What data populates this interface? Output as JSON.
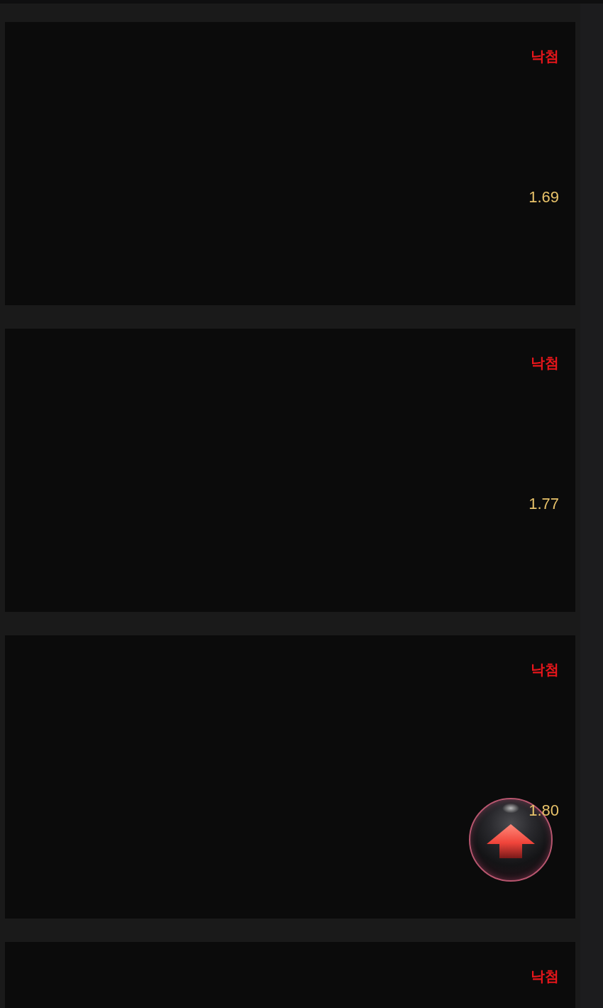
{
  "results": [
    {
      "status": "낙첨",
      "odds": "1.69"
    },
    {
      "status": "낙첨",
      "odds": "1.77"
    },
    {
      "status": "낙첨",
      "odds": "1.80"
    },
    {
      "status": "낙첨"
    }
  ]
}
